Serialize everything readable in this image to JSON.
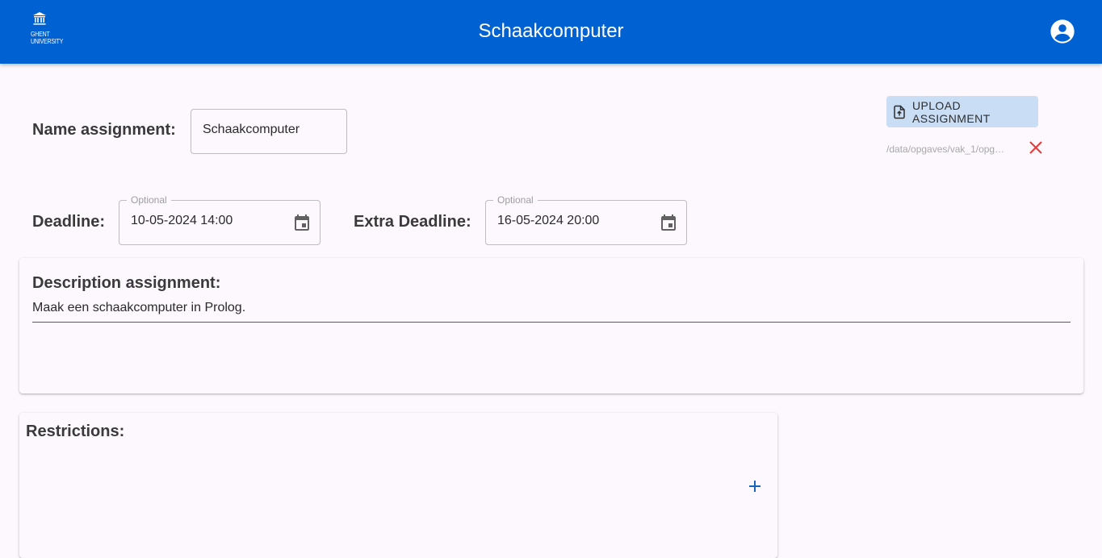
{
  "header": {
    "logo_text": "GHENT\nUNIVERSITY",
    "title": "Schaakcomputer",
    "account_icon": "account-circle-icon",
    "background": "#0061d3"
  },
  "form": {
    "name_label": "Name assignment:",
    "name_value": "Schaakcomputer",
    "deadline_label": "Deadline:",
    "deadline_hint": "Optional",
    "deadline_value": "10-05-2024 14:00",
    "extra_deadline_label": "Extra Deadline:",
    "extra_deadline_hint": "Optional",
    "extra_deadline_value": "16-05-2024 20:00",
    "calendar_icon": "calendar-icon"
  },
  "upload": {
    "button_label": "UPLOAD ASSIGNMENT",
    "file_path": "/data/opgaves/vak_1/opg…",
    "remove_icon": "close-icon",
    "button_color": "#c9ddf5",
    "remove_color": "#e53935"
  },
  "description": {
    "title": "Description assignment:",
    "value": "Maak een schaakcomputer in Prolog."
  },
  "restrictions": {
    "title": "Restrictions:",
    "add_icon": "plus-icon",
    "accent": "#1565c0"
  }
}
